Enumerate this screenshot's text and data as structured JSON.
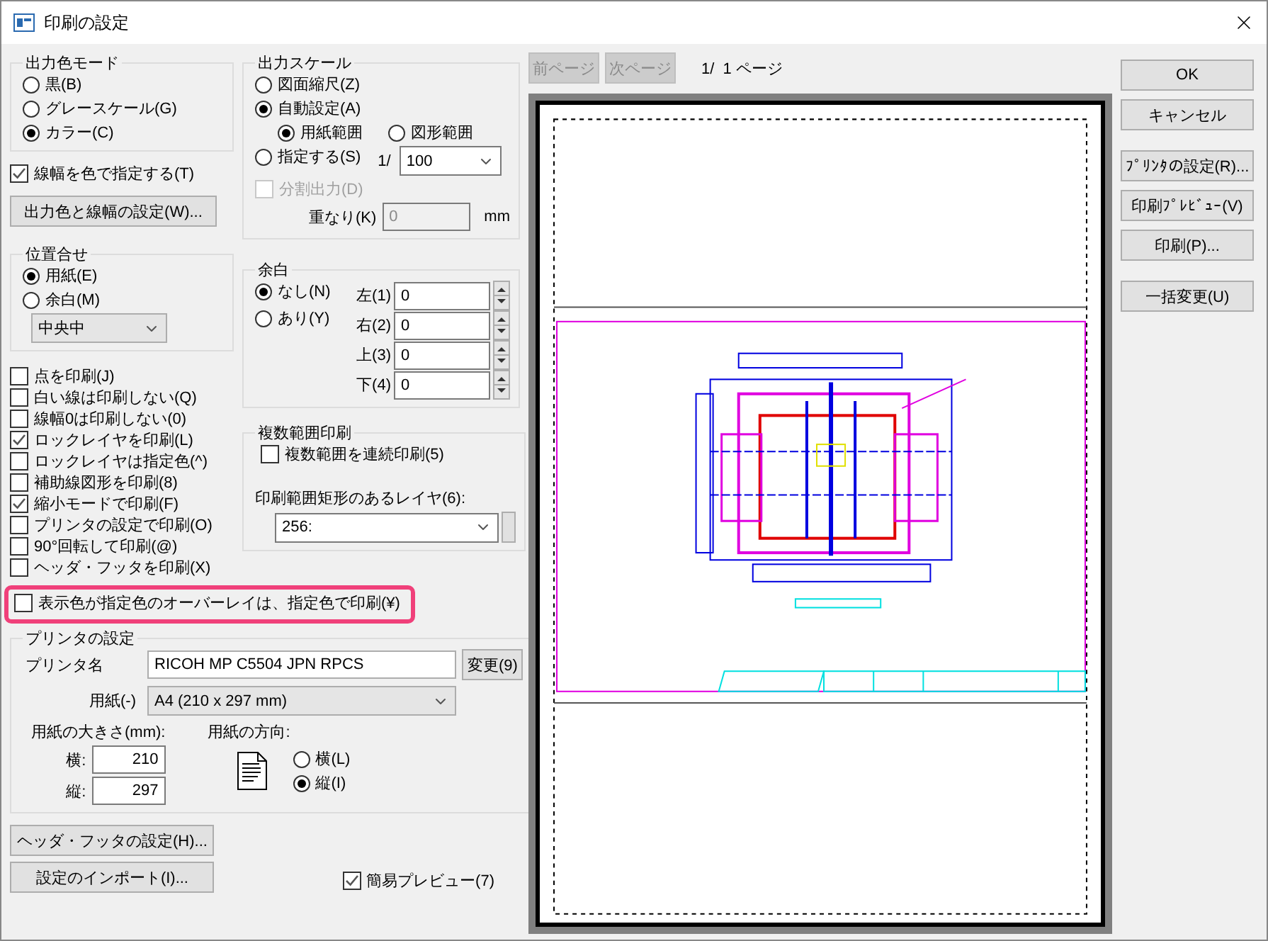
{
  "window": {
    "title": "印刷の設定"
  },
  "output_color_mode": {
    "title": "出力色モード",
    "options": [
      {
        "label": "黒(B)",
        "selected": false
      },
      {
        "label": "グレースケール(G)",
        "selected": false
      },
      {
        "label": "カラー(C)",
        "selected": true
      }
    ],
    "line_width_by_color": {
      "label": "線幅を色で指定する(T)",
      "checked": true
    },
    "settings_button": "出力色と線幅の設定(W)..."
  },
  "output_scale": {
    "title": "出力スケール",
    "options": [
      {
        "label": "図面縮尺(Z)",
        "selected": false
      },
      {
        "label": "自動設定(A)",
        "selected": true
      },
      {
        "label": "指定する(S)",
        "selected": false
      }
    ],
    "auto_options": [
      {
        "label": "用紙範囲",
        "selected": true
      },
      {
        "label": "図形範囲",
        "selected": false
      }
    ],
    "ratio_prefix": "1/",
    "ratio_value": "100",
    "split_output": {
      "label": "分割出力(D)",
      "checked": false,
      "disabled": true
    },
    "overlap_label": "重なり(K)",
    "overlap_value": "0",
    "overlap_unit": "mm"
  },
  "position": {
    "title": "位置合せ",
    "options": [
      {
        "label": "用紙(E)",
        "selected": true
      },
      {
        "label": "余白(M)",
        "selected": false
      }
    ],
    "alignment": "中央中"
  },
  "margin": {
    "title": "余白",
    "options": [
      {
        "label": "なし(N)",
        "selected": true
      },
      {
        "label": "あり(Y)",
        "selected": false
      }
    ],
    "fields": [
      {
        "label": "左(1)",
        "value": "0"
      },
      {
        "label": "右(2)",
        "value": "0"
      },
      {
        "label": "上(3)",
        "value": "0"
      },
      {
        "label": "下(4)",
        "value": "0"
      }
    ]
  },
  "print_options": [
    {
      "label": "点を印刷(J)",
      "checked": false
    },
    {
      "label": "白い線は印刷しない(Q)",
      "checked": false
    },
    {
      "label": "線幅0は印刷しない(0)",
      "checked": false
    },
    {
      "label": "ロックレイヤを印刷(L)",
      "checked": true
    },
    {
      "label": "ロックレイヤは指定色(^)",
      "checked": false
    },
    {
      "label": "補助線図形を印刷(8)",
      "checked": false
    },
    {
      "label": "縮小モードで印刷(F)",
      "checked": true
    },
    {
      "label": "プリンタの設定で印刷(O)",
      "checked": false
    },
    {
      "label": "90°回転して印刷(@)",
      "checked": false
    },
    {
      "label": "ヘッダ・フッタを印刷(X)",
      "checked": false
    }
  ],
  "multi_range": {
    "title": "複数範囲印刷",
    "continuous": {
      "label": "複数範囲を連続印刷(5)",
      "checked": false
    },
    "layer_label": "印刷範囲矩形のあるレイヤ(6):",
    "layer_value": "256:"
  },
  "overlay_option": {
    "label": "表示色が指定色のオーバーレイは、指定色で印刷(¥)",
    "checked": false,
    "highlighted": true
  },
  "printer": {
    "title": "プリンタの設定",
    "name_label": "プリンタ名",
    "name_value": "RICOH MP C5504 JPN RPCS",
    "change_button": "変更(9)",
    "paper_label": "用紙(-)",
    "paper_value": "A4 (210 x 297 mm)",
    "size_label": "用紙の大きさ(mm):",
    "width_label": "横:",
    "width_value": "210",
    "height_label": "縦:",
    "height_value": "297",
    "orientation_label": "用紙の方向:",
    "orientation_options": [
      {
        "label": "横(L)",
        "selected": false
      },
      {
        "label": "縦(I)",
        "selected": true
      }
    ]
  },
  "bottom_buttons": [
    "ヘッダ・フッタの設定(H)...",
    "設定のインポート(I)..."
  ],
  "simple_preview": {
    "label": "簡易プレビュー(7)",
    "checked": true
  },
  "preview": {
    "prev_button": {
      "label": "前ページ",
      "disabled": true
    },
    "next_button": {
      "label": "次ページ",
      "disabled": true
    },
    "page_info": "1/  1 ページ"
  },
  "side_buttons": [
    "OK",
    "キャンセル",
    "ﾌﾟﾘﾝﾀの設定(R)...",
    "印刷ﾌﾟﾚﾋﾞｭｰ(V)",
    "印刷(P)...",
    "一括変更(U)"
  ]
}
